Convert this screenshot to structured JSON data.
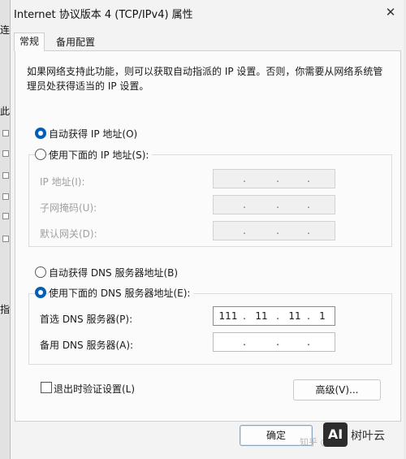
{
  "window": {
    "title": "Internet 协议版本 4 (TCP/IPv4) 属性",
    "close_glyph": "✕"
  },
  "background": {
    "chars": [
      "连",
      "此",
      "指"
    ]
  },
  "tabs": {
    "general": "常规",
    "alternate": "备用配置"
  },
  "description": "如果网络支持此功能，则可以获取自动指派的 IP 设置。否则，你需要从网络系统管理员处获得适当的 IP 设置。",
  "ip_section": {
    "auto_label": "自动获得 IP 地址(O)",
    "manual_label": "使用下面的 IP 地址(S):",
    "selected": "auto",
    "fields": [
      {
        "label": "IP 地址(I):",
        "octets": [
          "",
          "",
          "",
          ""
        ]
      },
      {
        "label": "子网掩码(U):",
        "octets": [
          "",
          "",
          "",
          ""
        ]
      },
      {
        "label": "默认网关(D):",
        "octets": [
          "",
          "",
          "",
          ""
        ]
      }
    ]
  },
  "dns_section": {
    "auto_label": "自动获得 DNS 服务器地址(B)",
    "manual_label": "使用下面的 DNS 服务器地址(E):",
    "selected": "manual",
    "preferred": {
      "label": "首选 DNS 服务器(P):",
      "octets": [
        "111",
        "11",
        "11",
        "1"
      ]
    },
    "alternate": {
      "label": "备用 DNS 服务器(A):",
      "octets": [
        "",
        "",
        "",
        ""
      ]
    }
  },
  "validate_on_exit": {
    "label": "退出时验证设置(L)",
    "checked": false
  },
  "buttons": {
    "advanced": "高级(V)...",
    "ok": "确定"
  },
  "watermark": {
    "logo": "AI",
    "text": "树叶云",
    "faint": "知乎 @"
  },
  "icons": {
    "close": "close-icon",
    "radio": "radio-button",
    "checkbox": "checkbox"
  }
}
